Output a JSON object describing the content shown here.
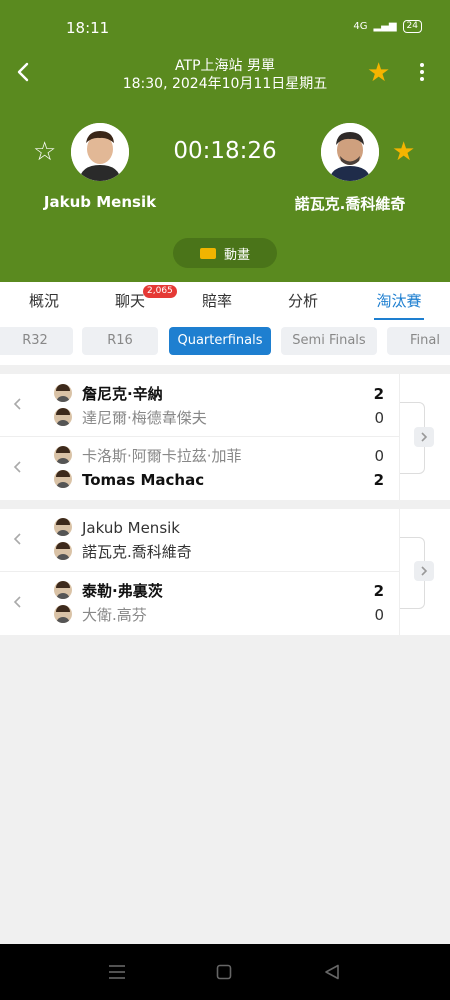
{
  "status_bar": {
    "time": "18:11",
    "network": "4G",
    "battery": "24"
  },
  "header": {
    "title": "ATP上海站 男單",
    "subtitle": "18:30, 2024年10月11日星期五",
    "clock": "00:18:26",
    "anim_label": "動畫",
    "accent": "#5a8a1f",
    "fav_color": "#f4b400"
  },
  "players": {
    "home": {
      "name": "Jakub Mensik",
      "favorited": false
    },
    "away": {
      "name": "諾瓦克.喬科維奇",
      "favorited": true
    }
  },
  "tabs": [
    {
      "label": "概況",
      "active": false
    },
    {
      "label": "聊天",
      "active": false,
      "badge": "2,065"
    },
    {
      "label": "賠率",
      "active": false
    },
    {
      "label": "分析",
      "active": false
    },
    {
      "label": "淘汰賽",
      "active": true
    }
  ],
  "rounds": [
    {
      "label": "R32",
      "active": false
    },
    {
      "label": "R16",
      "active": false
    },
    {
      "label": "Quarterfinals",
      "active": true
    },
    {
      "label": "Semi Finals",
      "active": false
    },
    {
      "label": "Final",
      "active": false
    }
  ],
  "bracket": [
    {
      "matches": [
        {
          "p1": "詹尼克·辛納",
          "s1": "2",
          "p2": "達尼爾·梅德韋傑夫",
          "s2": "0"
        },
        {
          "p1": "卡洛斯·阿爾卡拉茲·加菲",
          "s1": "0",
          "p2": "Tomas Machac",
          "s2": "2"
        }
      ]
    },
    {
      "matches": [
        {
          "p1": "Jakub Mensik",
          "s1": "",
          "p2": "諾瓦克.喬科維奇",
          "s2": ""
        },
        {
          "p1": "泰勒·弗裏茨",
          "s1": "2",
          "p2": "大衛.高芬",
          "s2": "0"
        }
      ]
    }
  ]
}
